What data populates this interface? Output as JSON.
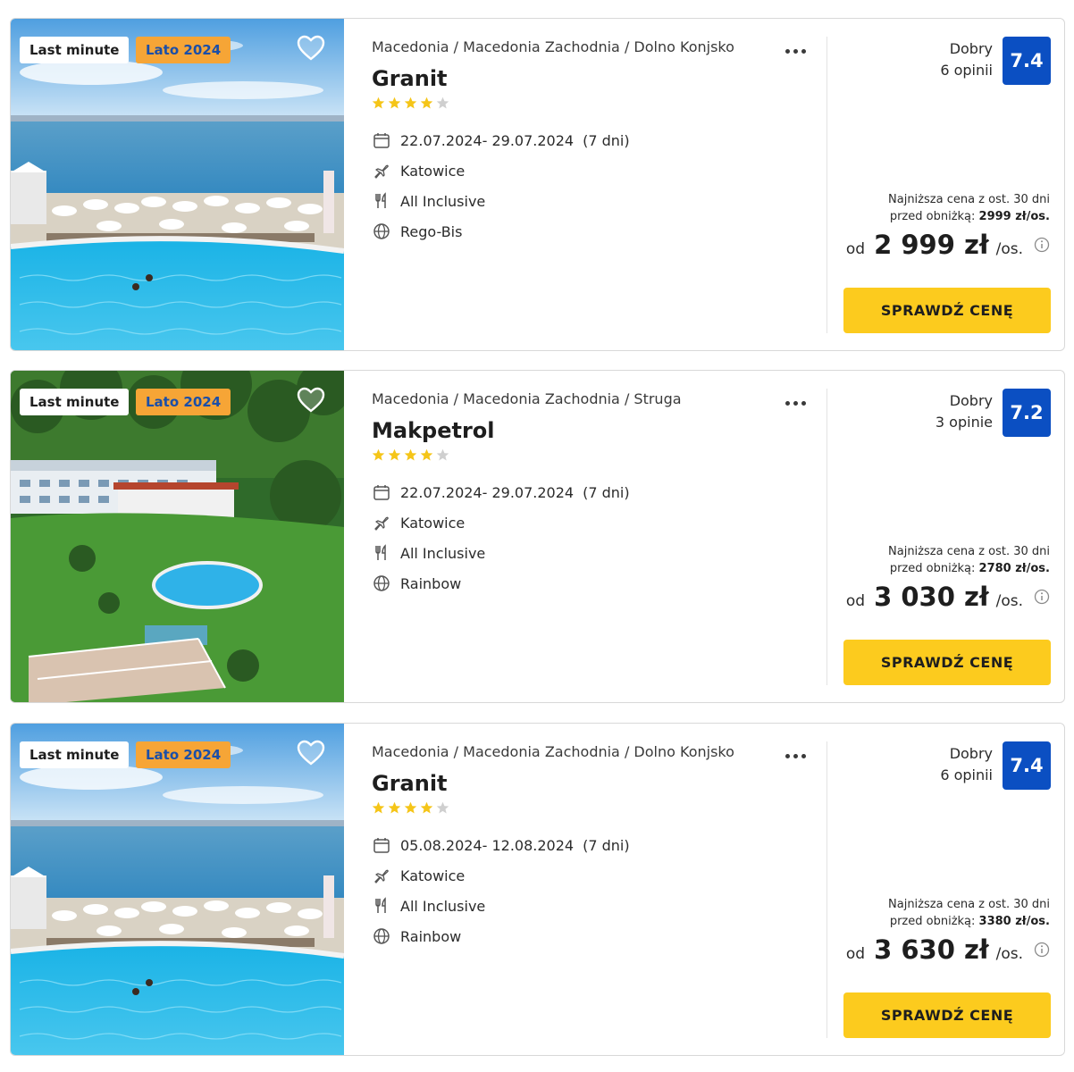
{
  "offers": [
    {
      "badge_last_minute": "Last minute",
      "badge_season": "Lato 2024",
      "breadcrumb": "Macedonia / Macedonia Zachodnia / Dolno Konjsko",
      "hotel_name": "Granit",
      "stars": 4,
      "dates": "22.07.2024- 29.07.2024",
      "duration": "(7 dni)",
      "departure": "Katowice",
      "board": "All Inclusive",
      "operator": "Rego-Bis",
      "rating_label": "Dobry",
      "reviews": "6 opinii",
      "rating": "7.4",
      "lowest_line1": "Najniższa cena z ost. 30 dni",
      "lowest_line2_prefix": "przed obniżką: ",
      "lowest_value": "2999 zł/os.",
      "price_prefix": "od",
      "price": "2 999 zł",
      "price_suffix": "/os.",
      "cta": "SPRAWDŹ CENĘ",
      "photo": "lake-pool"
    },
    {
      "badge_last_minute": "Last minute",
      "badge_season": "Lato 2024",
      "breadcrumb": "Macedonia / Macedonia Zachodnia / Struga",
      "hotel_name": "Makpetrol",
      "stars": 4,
      "dates": "22.07.2024- 29.07.2024",
      "duration": "(7 dni)",
      "departure": "Katowice",
      "board": "All Inclusive",
      "operator": "Rainbow",
      "rating_label": "Dobry",
      "reviews": "3 opinie",
      "rating": "7.2",
      "lowest_line1": "Najniższa cena z ost. 30 dni",
      "lowest_line2_prefix": "przed obniżką: ",
      "lowest_value": "2780 zł/os.",
      "price_prefix": "od",
      "price": "3 030 zł",
      "price_suffix": "/os.",
      "cta": "SPRAWDŹ CENĘ",
      "photo": "hotel-forest"
    },
    {
      "badge_last_minute": "Last minute",
      "badge_season": "Lato 2024",
      "breadcrumb": "Macedonia / Macedonia Zachodnia / Dolno Konjsko",
      "hotel_name": "Granit",
      "stars": 4,
      "dates": "05.08.2024- 12.08.2024",
      "duration": "(7 dni)",
      "departure": "Katowice",
      "board": "All Inclusive",
      "operator": "Rainbow",
      "rating_label": "Dobry",
      "reviews": "6 opinii",
      "rating": "7.4",
      "lowest_line1": "Najniższa cena z ost. 30 dni",
      "lowest_line2_prefix": "przed obniżką: ",
      "lowest_value": "3380 zł/os.",
      "price_prefix": "od",
      "price": "3 630 zł",
      "price_suffix": "/os.",
      "cta": "SPRAWDŹ CENĘ",
      "photo": "lake-pool"
    }
  ],
  "colors": {
    "rating_bg": "#0b4fc2",
    "cta_bg": "#fccb1e",
    "season_badge_bg": "#f6a536",
    "season_badge_text": "#1b4fa8",
    "star_filled": "#f5c518",
    "star_empty": "#cfcfcf"
  },
  "icons": [
    "heart-icon",
    "more-icon",
    "star-icon",
    "calendar-icon",
    "plane-icon",
    "cutlery-icon",
    "globe-icon",
    "info-icon"
  ]
}
